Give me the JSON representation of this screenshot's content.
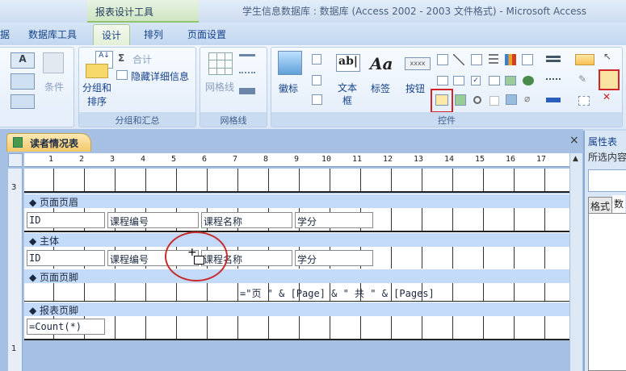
{
  "titlebar": {
    "context_tab": "报表设计工具",
    "title": "学生信息数据库 : 数据库 (Access 2002 - 2003 文件格式) - Microsoft Access"
  },
  "tabs": [
    {
      "label": "据"
    },
    {
      "label": "数据库工具"
    },
    {
      "label": "设计",
      "active": true
    },
    {
      "label": "排列"
    },
    {
      "label": "页面设置"
    }
  ],
  "ribbon": {
    "font_group": {
      "conditional": "条件"
    },
    "grouping": {
      "group_sort": "分组和\n排序",
      "totals": "合计",
      "hide_details": "隐藏详细信息",
      "label": "分组和汇总"
    },
    "gridlines": {
      "gridlines": "网格线",
      "label": "网格线"
    },
    "controls": {
      "logo": "徽标",
      "textbox": "文本\n框",
      "label_ctl": "标签",
      "button": "按钮",
      "button_face": "xxxx",
      "label": "控件"
    }
  },
  "document": {
    "tab": "读者情况表",
    "close": "×",
    "ruler": [
      "1",
      "2",
      "3",
      "4",
      "5",
      "6",
      "7",
      "8",
      "9",
      "10",
      "11",
      "12",
      "13",
      "14",
      "15",
      "16",
      "17"
    ],
    "vruler": [
      "3",
      "1"
    ],
    "sections": {
      "page_header": "页面页眉",
      "detail": "主体",
      "page_footer": "页面页脚",
      "report_footer": "报表页脚"
    },
    "header_labels": [
      "ID",
      "课程编号",
      "课程名称",
      "学分"
    ],
    "detail_fields": [
      "ID",
      "课程编号",
      "课程名称",
      "学分"
    ],
    "page_footer_expr": "=\"页 \" & [Page] & \" 共 \" & [Pages]",
    "report_footer_expr": "=Count(*)"
  },
  "property_sheet": {
    "title": "属性表",
    "selection_label": "所选内容",
    "tabs": [
      "格式",
      "数"
    ]
  }
}
